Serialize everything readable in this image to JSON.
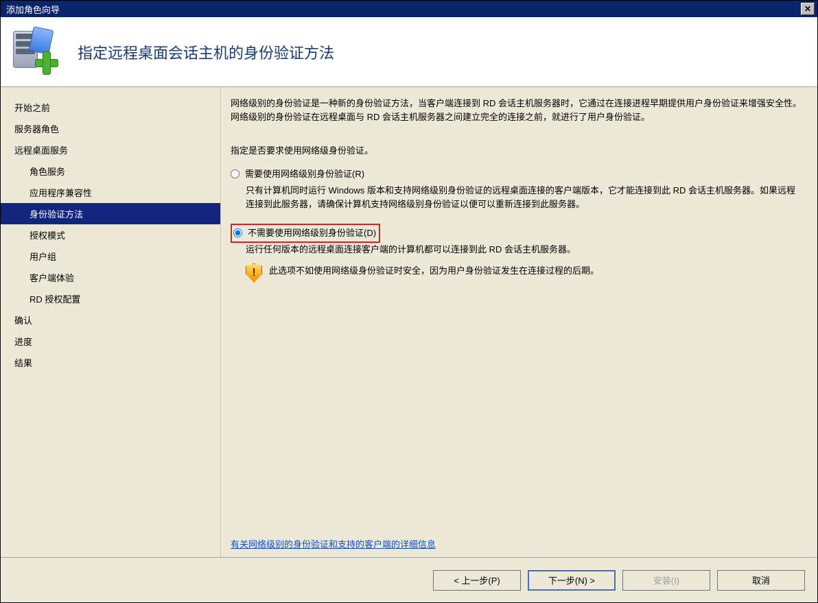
{
  "window": {
    "title": "添加角色向导"
  },
  "header": {
    "title": "指定远程桌面会话主机的身份验证方法"
  },
  "sidebar": {
    "items": [
      {
        "label": "开始之前",
        "sub": false,
        "active": false
      },
      {
        "label": "服务器角色",
        "sub": false,
        "active": false
      },
      {
        "label": "远程桌面服务",
        "sub": false,
        "active": false
      },
      {
        "label": "角色服务",
        "sub": true,
        "active": false
      },
      {
        "label": "应用程序兼容性",
        "sub": true,
        "active": false
      },
      {
        "label": "身份验证方法",
        "sub": true,
        "active": true
      },
      {
        "label": "授权模式",
        "sub": true,
        "active": false
      },
      {
        "label": "用户组",
        "sub": true,
        "active": false
      },
      {
        "label": "客户端体验",
        "sub": true,
        "active": false
      },
      {
        "label": "RD 授权配置",
        "sub": true,
        "active": false
      },
      {
        "label": "确认",
        "sub": false,
        "active": false
      },
      {
        "label": "进度",
        "sub": false,
        "active": false
      },
      {
        "label": "结果",
        "sub": false,
        "active": false
      }
    ]
  },
  "content": {
    "description": "网络级别的身份验证是一种新的身份验证方法，当客户端连接到 RD 会话主机服务器时，它通过在连接进程早期提供用户身份验证来增强安全性。网络级别的身份验证在远程桌面与 RD 会话主机服务器之间建立完全的连接之前，就进行了用户身份验证。",
    "prompt": "指定是否要求使用网络级身份验证。",
    "option1": {
      "label": "需要使用网络级别身份验证(R)",
      "help": "只有计算机同时运行 Windows 版本和支持网络级别身份验证的远程桌面连接的客户端版本，它才能连接到此 RD 会话主机服务器。如果远程连接到此服务器，请确保计算机支持网络级别身份验证以便可以重新连接到此服务器。"
    },
    "option2": {
      "label": "不需要使用网络级别身份验证(D)",
      "help": "运行任何版本的远程桌面连接客户端的计算机都可以连接到此 RD 会话主机服务器。",
      "warning": "此选项不如使用网络级身份验证时安全，因为用户身份验证发生在连接过程的后期。"
    },
    "link": "有关网络级别的身份验证和支持的客户端的详细信息"
  },
  "footer": {
    "prev": "< 上一步(P)",
    "next": "下一步(N) >",
    "install": "安装(I)",
    "cancel": "取消"
  }
}
